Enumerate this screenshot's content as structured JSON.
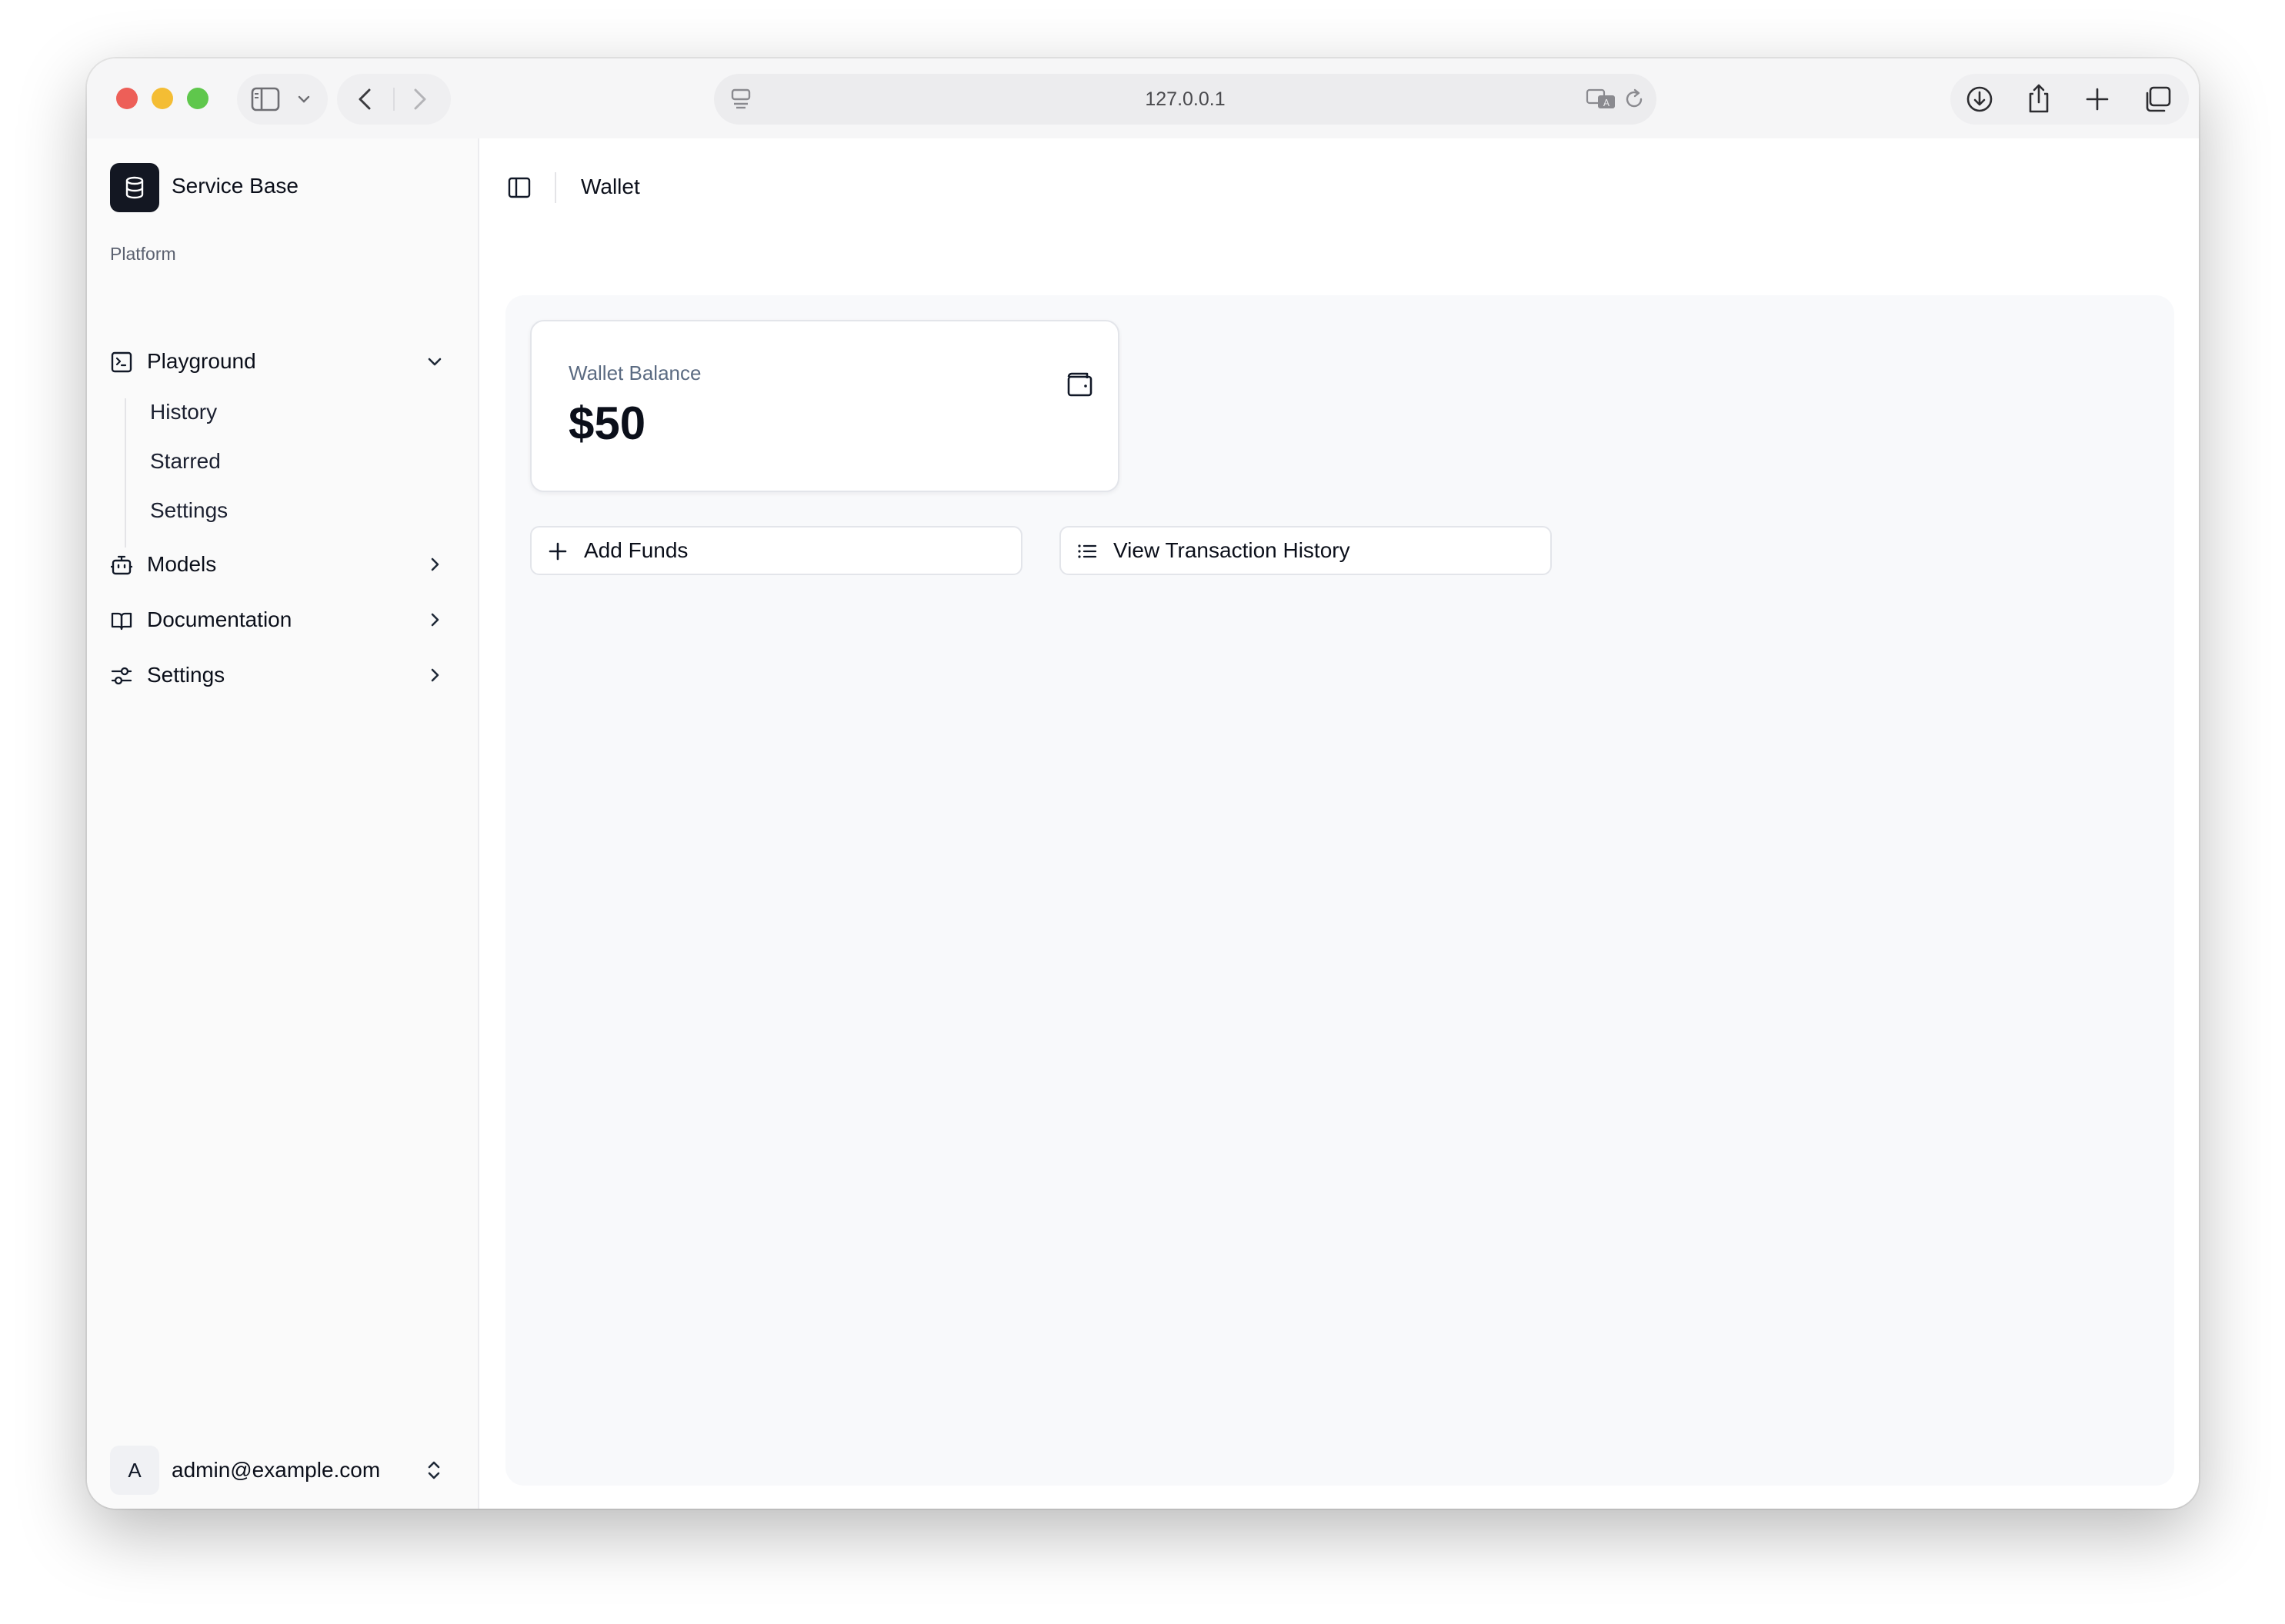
{
  "browser": {
    "url": "127.0.0.1"
  },
  "sidebar": {
    "brand": "Service Base",
    "section_label": "Platform",
    "items": [
      {
        "label": "Playground",
        "expanded": true,
        "children": [
          "History",
          "Starred",
          "Settings"
        ]
      },
      {
        "label": "Models"
      },
      {
        "label": "Documentation"
      },
      {
        "label": "Settings"
      }
    ],
    "user": {
      "initial": "A",
      "email": "admin@example.com"
    }
  },
  "main": {
    "breadcrumb": "Wallet",
    "balance_card": {
      "label": "Wallet Balance",
      "value": "$50"
    },
    "actions": {
      "add_funds": "Add Funds",
      "view_history": "View Transaction History"
    }
  },
  "colors": {
    "brand_logo_bg": "#131722",
    "content_bg": "#f8f9fb",
    "muted_text": "#5b6b82"
  }
}
